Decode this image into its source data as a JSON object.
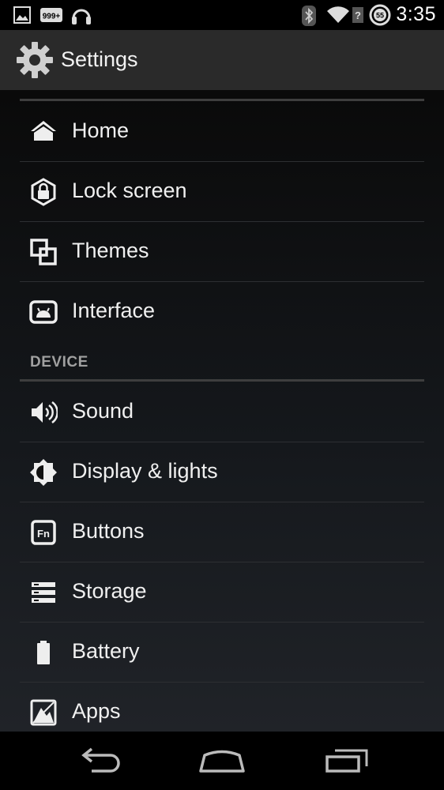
{
  "status_bar": {
    "time": "3:35",
    "notification_badge": "999+",
    "battery_level": "55",
    "icons": [
      "image-icon",
      "notification-count-icon",
      "headphones-icon",
      "bluetooth-icon",
      "wifi-icon",
      "no-signal-icon",
      "battery-icon"
    ]
  },
  "action_bar": {
    "title": "Settings",
    "icon": "gear-icon"
  },
  "groups": [
    {
      "items": [
        {
          "label": "Home",
          "icon": "home-icon"
        },
        {
          "label": "Lock screen",
          "icon": "lock-icon"
        },
        {
          "label": "Themes",
          "icon": "themes-icon"
        },
        {
          "label": "Interface",
          "icon": "interface-icon"
        }
      ]
    },
    {
      "header": "DEVICE",
      "items": [
        {
          "label": "Sound",
          "icon": "speaker-icon"
        },
        {
          "label": "Display & lights",
          "icon": "brightness-icon"
        },
        {
          "label": "Buttons",
          "icon": "fn-key-icon"
        },
        {
          "label": "Storage",
          "icon": "storage-icon"
        },
        {
          "label": "Battery",
          "icon": "battery-icon"
        },
        {
          "label": "Apps",
          "icon": "apps-icon"
        }
      ]
    }
  ],
  "nav_bar": {
    "buttons": [
      "back-icon",
      "home-nav-icon",
      "recents-icon"
    ]
  },
  "colors": {
    "text": "#f0f0f0",
    "section_header": "#a0a0a0",
    "divider": "#2d2f32",
    "action_bar_bg": "#2a2a2a"
  }
}
